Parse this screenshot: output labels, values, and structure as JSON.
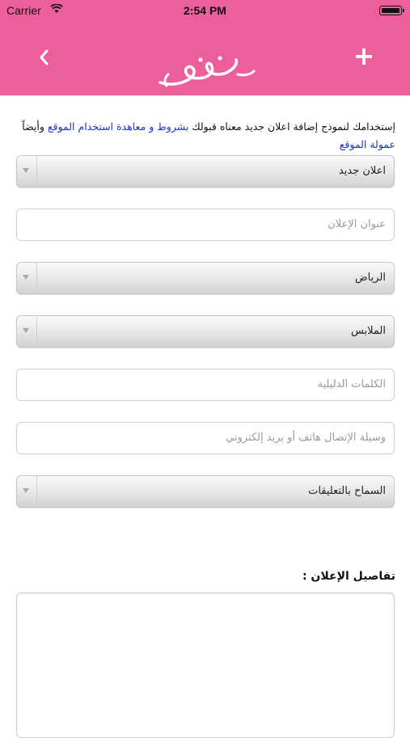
{
  "status_bar": {
    "carrier": "Carrier",
    "time": "2:54 PM"
  },
  "nav": {
    "back_icon": "chevron-left-icon",
    "add_icon": "plus-icon",
    "logo_text": "حراج المرأة"
  },
  "notice": {
    "text": "إستخدامك لنموذج إضافة اعلان جديد معناه قبولك ",
    "link1": "بشروط و معاهدة استخدام الموقع",
    "middle": " وأيضاً ",
    "link2": "عمولة الموقع",
    "link_color": "#1b2fd6"
  },
  "form": {
    "ad_type": "اعلان جديد",
    "title_placeholder": "عنوان الإعلان",
    "city": "الرياض",
    "category": "الملابس",
    "keywords_placeholder": "الكلمات الدليلية",
    "contact_placeholder": "وسيلة الإتصال هاتف أو بريد إلكتروني",
    "comments": "السماح بالتعليقات",
    "details_label": "تفاصيل الإعلان :"
  },
  "colors": {
    "brand": "#ec5f9a"
  }
}
